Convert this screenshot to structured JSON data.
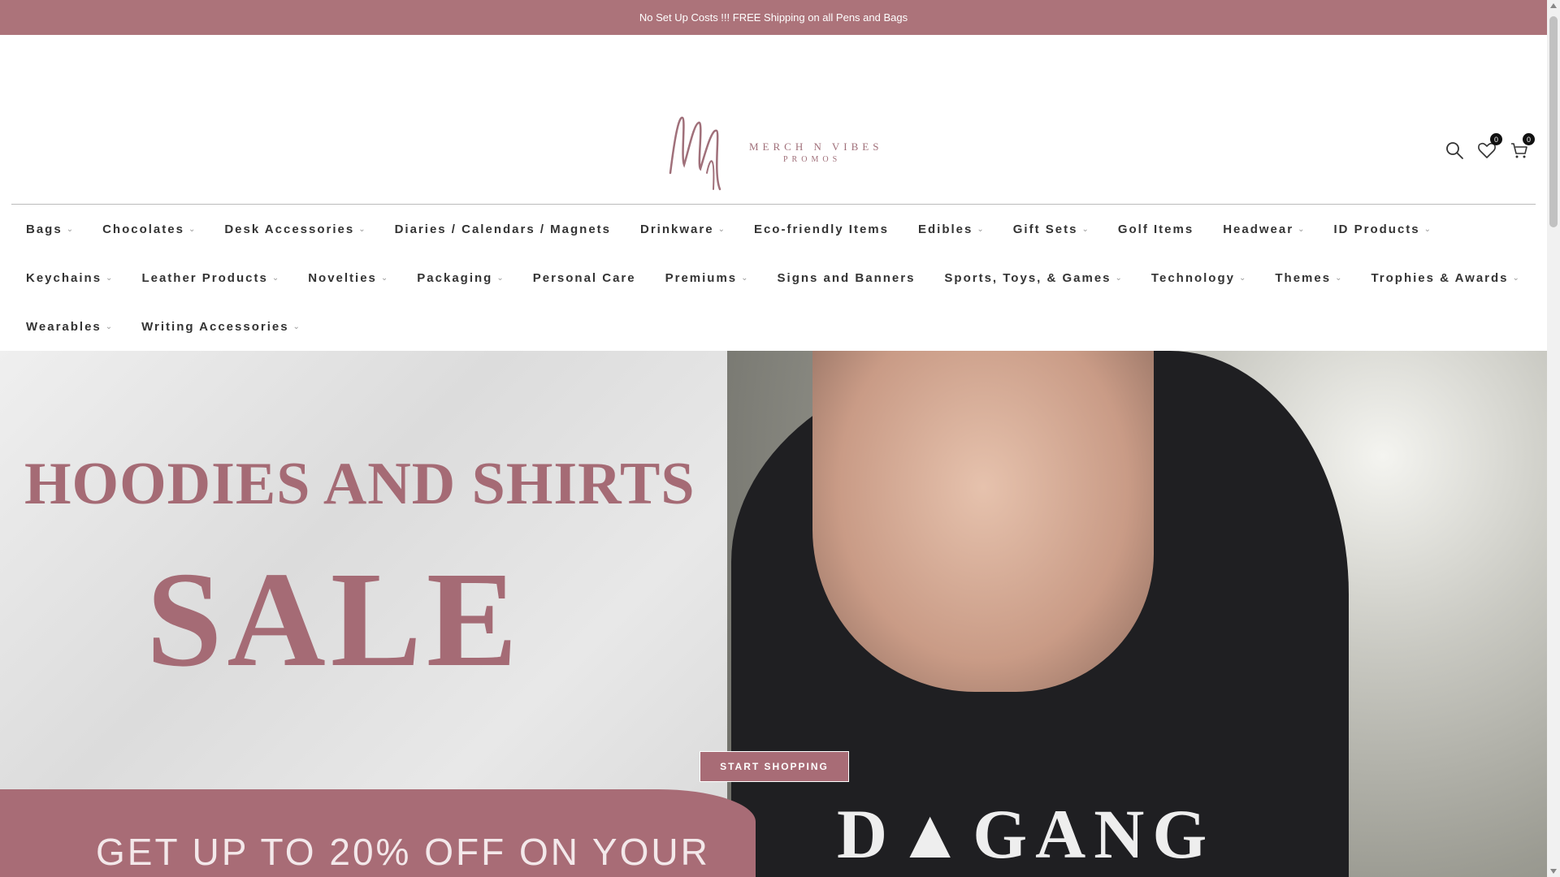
{
  "announcement": "No Set Up Costs !!! FREE Shipping on all Pens and Bags",
  "logo": {
    "line1": "MERCH N VIBES",
    "line2": "PROMOS"
  },
  "header": {
    "wishlist_count": "0",
    "cart_count": "0"
  },
  "nav": {
    "row1": [
      {
        "label": "Bags",
        "caret": "⌄"
      },
      {
        "label": "Chocolates",
        "caret": "⌄"
      },
      {
        "label": "Desk Accessories",
        "caret": "⌄"
      },
      {
        "label": "Diaries / Calendars / Magnets",
        "caret": ""
      },
      {
        "label": "Drinkware",
        "caret": "⌄"
      },
      {
        "label": "Eco-friendly Items",
        "caret": ""
      },
      {
        "label": "Edibles",
        "caret": "⌄"
      },
      {
        "label": "Gift Sets",
        "caret": "⌄"
      },
      {
        "label": "Golf Items",
        "caret": ""
      },
      {
        "label": "Headwear",
        "caret": "⌄"
      },
      {
        "label": "ID Products",
        "caret": "⌄"
      }
    ],
    "row2": [
      {
        "label": "Keychains",
        "caret": "⌄"
      },
      {
        "label": "Leather Products",
        "caret": "⌄"
      },
      {
        "label": "Novelties",
        "caret": "⌄"
      },
      {
        "label": "Packaging",
        "caret": "⌄"
      },
      {
        "label": "Personal Care",
        "caret": ""
      },
      {
        "label": "Premiums",
        "caret": "⌄"
      },
      {
        "label": "Signs and Banners",
        "caret": ""
      },
      {
        "label": "Sports, Toys, & Games",
        "caret": "⌄"
      },
      {
        "label": "Technology",
        "caret": "⌄"
      },
      {
        "label": "Themes",
        "caret": "⌄"
      },
      {
        "label": "Trophies & Awards",
        "caret": "⌄"
      }
    ],
    "row3": [
      {
        "label": "Wearables",
        "caret": "⌄"
      },
      {
        "label": "Writing Accessories",
        "caret": "⌄"
      }
    ]
  },
  "hero": {
    "title_line1": "HOODIES AND SHIRTS",
    "title_line2": "SALE",
    "cta": "START SHOPPING",
    "subtitle": "GET UP TO 20% OFF ON YOUR",
    "shirt_text": "D▲GANG"
  },
  "colors": {
    "brand": "#ac737a",
    "accent": "#a86c76"
  }
}
